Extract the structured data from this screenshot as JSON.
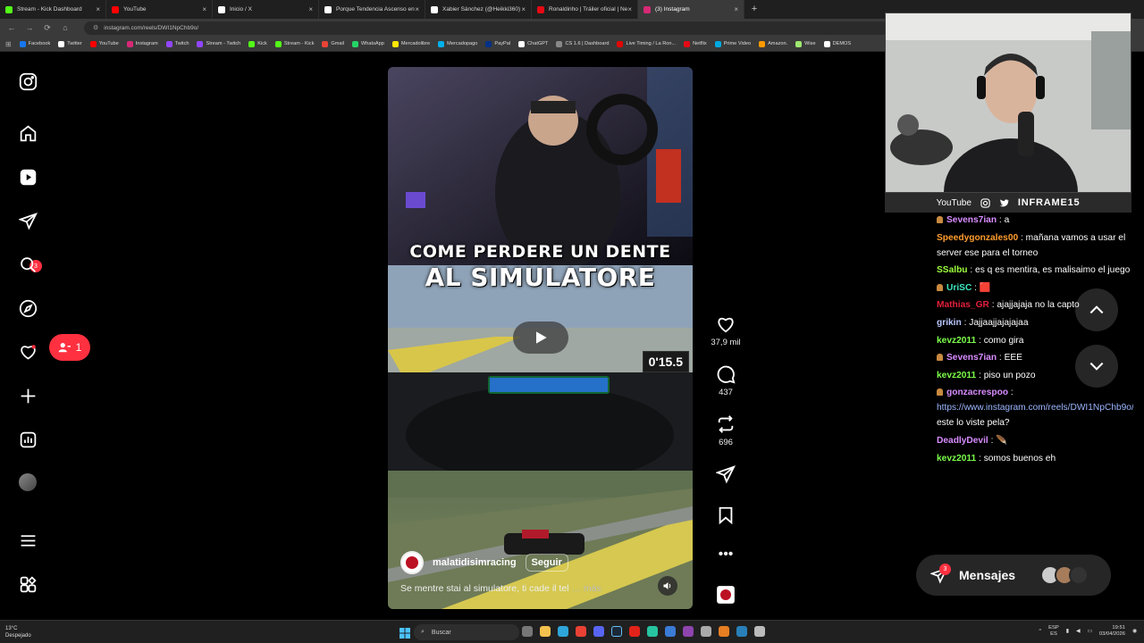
{
  "browser": {
    "tabs": [
      {
        "title": "Stream - Kick Dashboard",
        "color": "#53fc18",
        "active": false
      },
      {
        "title": "YouTube",
        "color": "#ff0000",
        "active": false
      },
      {
        "title": "Inicio / X",
        "color": "#ffffff",
        "active": false
      },
      {
        "title": "Porque Tendencia Ascenso en",
        "color": "#ffffff",
        "active": false
      },
      {
        "title": "Xabier Sánchez (@Heikki360) /",
        "color": "#ffffff",
        "active": false
      },
      {
        "title": "Ronaldinho | Tráiler oficial | Ne",
        "color": "#e50914",
        "active": false
      },
      {
        "title": "(3) Instagram",
        "color": "#d62976",
        "active": true
      }
    ],
    "url": "instagram.com/reels/DWI1NpChb9o/",
    "bookmarks": [
      {
        "label": "Facebook",
        "color": "#1877f2"
      },
      {
        "label": "Twitter",
        "color": "#ffffff"
      },
      {
        "label": "YouTube",
        "color": "#ff0000"
      },
      {
        "label": "Instagram",
        "color": "#d62976"
      },
      {
        "label": "Twitch",
        "color": "#9146ff"
      },
      {
        "label": "Stream - Twitch",
        "color": "#9146ff"
      },
      {
        "label": "Kick",
        "color": "#53fc18"
      },
      {
        "label": "Stream - Kick",
        "color": "#53fc18"
      },
      {
        "label": "Gmail",
        "color": "#ea4335"
      },
      {
        "label": "WhatsApp",
        "color": "#25d366"
      },
      {
        "label": "Mercadolibre",
        "color": "#ffe600"
      },
      {
        "label": "Mercadopago",
        "color": "#00b1ea"
      },
      {
        "label": "PayPal",
        "color": "#003087"
      },
      {
        "label": "ChatGPT",
        "color": "#ffffff"
      },
      {
        "label": "CS 1.6 | Dashboard",
        "color": "#888888"
      },
      {
        "label": "Live Timing / La Ron...",
        "color": "#e10600"
      },
      {
        "label": "Netflix",
        "color": "#e50914"
      },
      {
        "label": "Prime Video",
        "color": "#00a8e1"
      },
      {
        "label": "Amazon.",
        "color": "#ff9900"
      },
      {
        "label": "Wise",
        "color": "#9fe870"
      },
      {
        "label": "DEMOS",
        "color": "#ffffff"
      }
    ]
  },
  "instagram": {
    "notif_badge": "3",
    "follow_requests": "1",
    "reel": {
      "title_line1": "COME PERDERE UN DENTE",
      "title_line2": "AL SIMULATORE",
      "hud_time": "0'15.5",
      "username": "malatidisimracing",
      "follow_label": "Seguir",
      "caption": "Se mentre stai al simulatore, ti cade il tel",
      "more": "… más",
      "likes": "37,9 mil",
      "comments": "437",
      "reposts": "696"
    },
    "messages": {
      "label": "Mensajes",
      "badge": "3"
    }
  },
  "stream_overlay": {
    "youtube_label": "YouTube",
    "handle": "INFRAME15",
    "chat": [
      {
        "user": "Sevens7ian",
        "color": "#d88cff",
        "badge": true,
        "text": ": a"
      },
      {
        "user": "Speedygonzales00",
        "color": "#ff9c2e",
        "badge": false,
        "text": ": mañana vamos a usar el server ese para el torneo"
      },
      {
        "user": "SSalbu",
        "color": "#9dff3d",
        "badge": false,
        "text": ": es q es mentira, es malisaimo el juego"
      },
      {
        "user": "UriSC",
        "color": "#3ee6c0",
        "badge": true,
        "text": ": 🟥"
      },
      {
        "user": "Mathias_GR",
        "color": "#e3203b",
        "badge": false,
        "text": ": ajajjajaja no la capto"
      },
      {
        "user": "grikin",
        "color": "#b9c7ff",
        "badge": false,
        "text": ": Jajjaajjajajajaa"
      },
      {
        "user": "kevz2011",
        "color": "#7dff4a",
        "badge": false,
        "text": ": como gira"
      },
      {
        "user": "Sevens7ian",
        "color": "#d88cff",
        "badge": true,
        "text": ": EEE"
      },
      {
        "user": "kevz2011",
        "color": "#7dff4a",
        "badge": false,
        "text": ": piso un pozo"
      },
      {
        "user": "gonzacrespoo",
        "color": "#d88cff",
        "badge": true,
        "text": ":",
        "link": "https://www.instagram.com/reels/DWI1NpChb9o/",
        "after": " este lo viste pela?"
      },
      {
        "user": "DeadlyDevil",
        "color": "#d88cff",
        "badge": false,
        "text": ": 🪶"
      },
      {
        "user": "kevz2011",
        "color": "#7dff4a",
        "badge": false,
        "text": ": somos buenos eh"
      }
    ]
  },
  "taskbar": {
    "weather_temp": "13°C",
    "weather_desc": "Despejado",
    "search_placeholder": "Buscar",
    "lang1": "ESP",
    "lang2": "ES",
    "time": "19:51",
    "date": "03/04/2026"
  }
}
